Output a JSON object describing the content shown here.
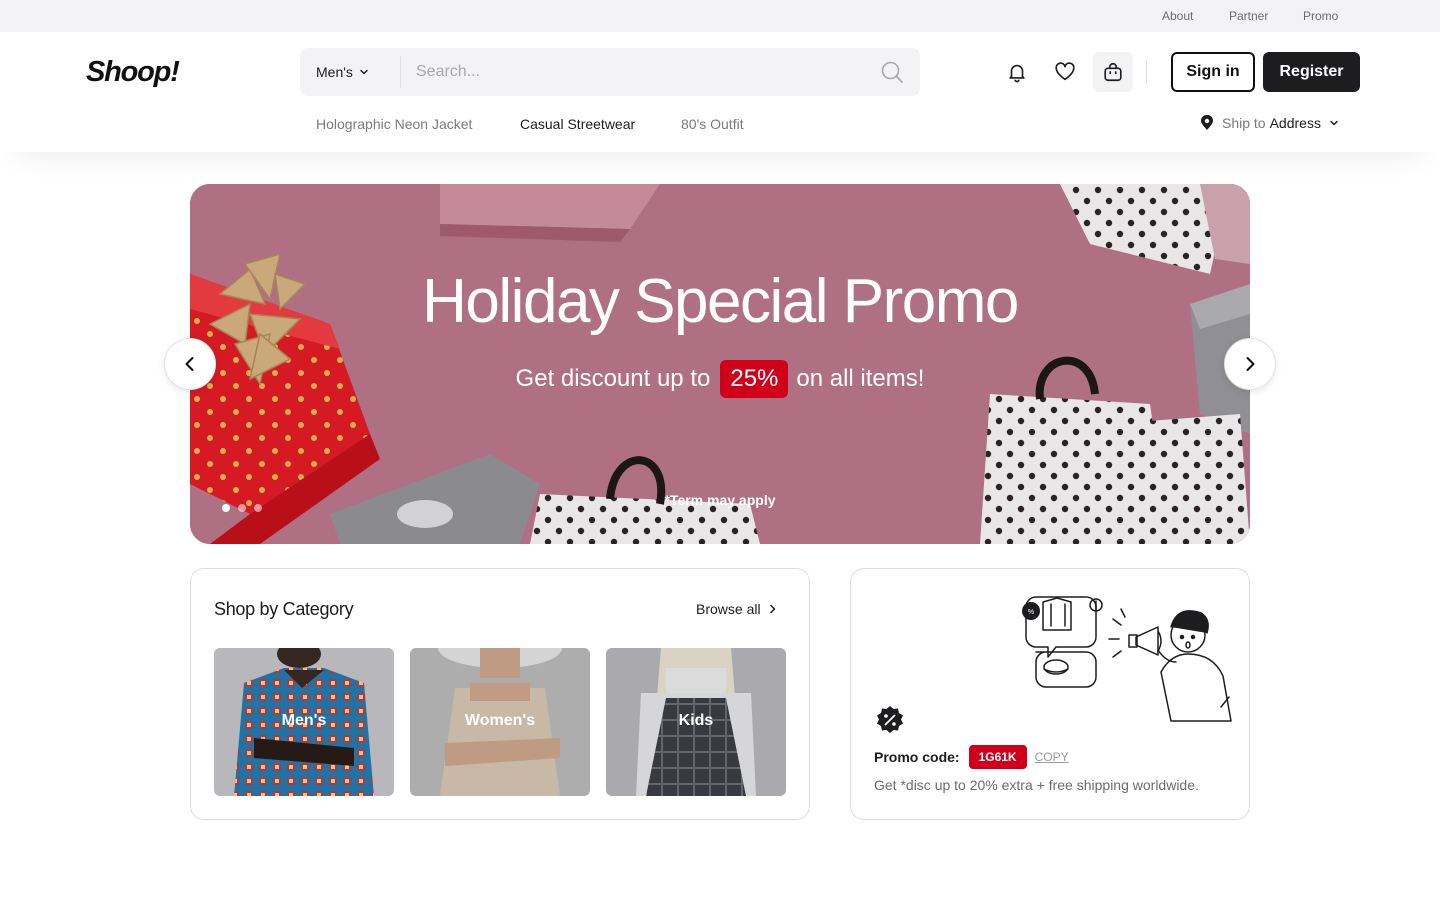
{
  "topbar": {
    "about": "About",
    "partner": "Partner",
    "promo": "Promo"
  },
  "header": {
    "logo": "Shoop!",
    "search": {
      "category": "Men's",
      "placeholder": "Search..."
    },
    "sign_in": "Sign in",
    "register": "Register",
    "subnav": [
      "Holographic Neon Jacket",
      "Casual Streetwear",
      "80's Outfit"
    ],
    "ship_to": {
      "prefix": "Ship to",
      "value": "Address"
    }
  },
  "hero": {
    "title": "Holiday Special Promo",
    "subtitle_before": "Get discount up to",
    "discount": "25%",
    "subtitle_after": "on all items!",
    "note": "*Term may apply",
    "slide_count": 3,
    "active_slide": 1
  },
  "category": {
    "title": "Shop by Category",
    "browse_all": "Browse all",
    "items": [
      "Men's",
      "Women's",
      "Kids"
    ]
  },
  "promo": {
    "label": "Promo code:",
    "code": "1G61K",
    "copy": "COPY",
    "description": "Get *disc up to 20% extra + free shipping worldwide."
  },
  "colors": {
    "accent_red": "#d0001b",
    "hero_bg": "#b07183",
    "dark": "#1d1d1f"
  }
}
